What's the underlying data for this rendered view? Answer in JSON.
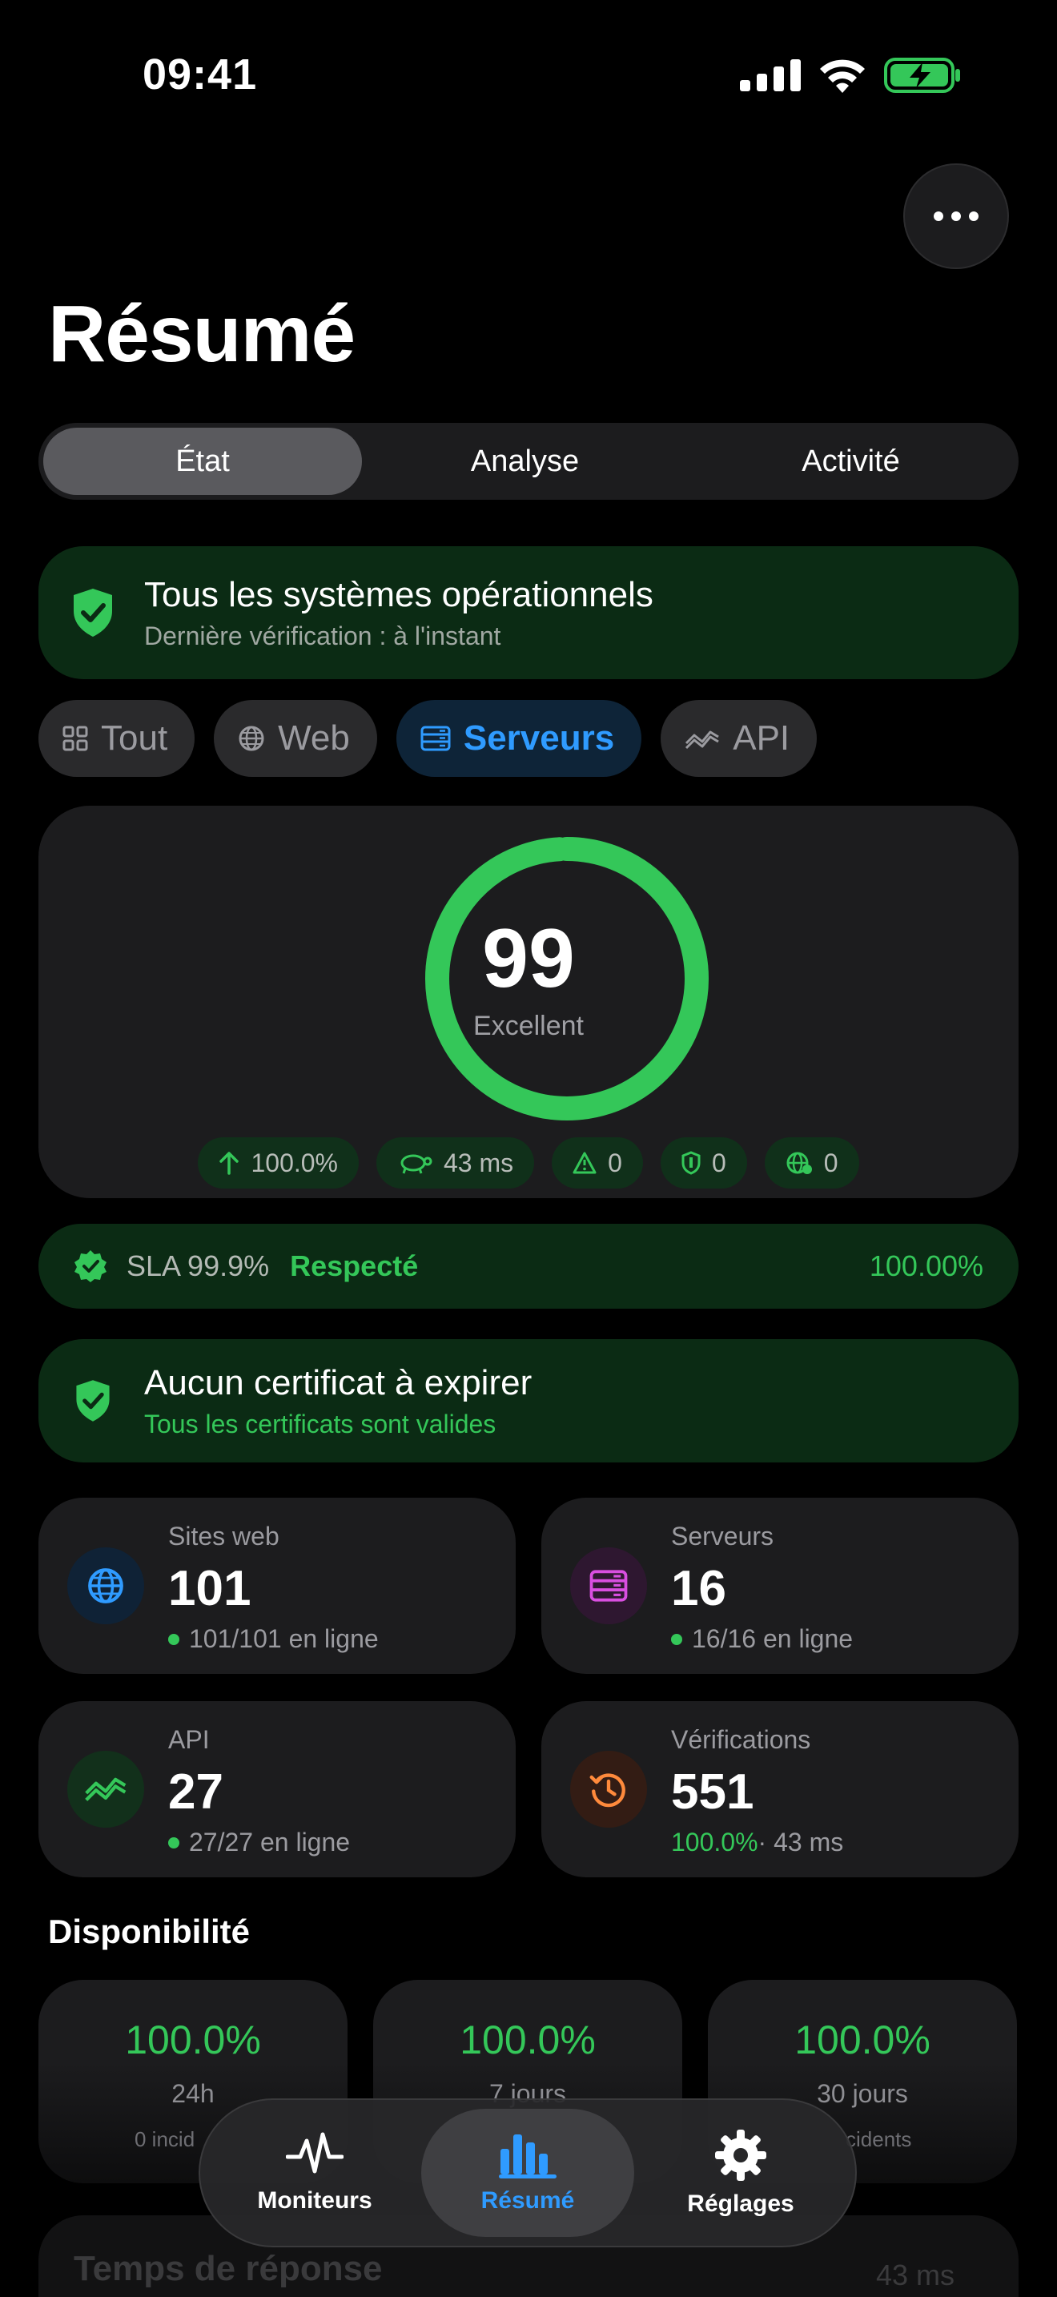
{
  "status_bar": {
    "time": "09:41"
  },
  "header": {
    "title": "Résumé"
  },
  "segments": [
    {
      "label": "État",
      "active": true
    },
    {
      "label": "Analyse",
      "active": false
    },
    {
      "label": "Activité",
      "active": false
    }
  ],
  "status_banner": {
    "title": "Tous les systèmes opérationnels",
    "subtitle": "Dernière vérification : à l'instant"
  },
  "filters": [
    {
      "label": "Tout",
      "icon": "grid-icon",
      "active": false
    },
    {
      "label": "Web",
      "icon": "globe-icon",
      "active": false
    },
    {
      "label": "Serveurs",
      "icon": "server-icon",
      "active": true
    },
    {
      "label": "API",
      "icon": "api-icon",
      "active": false
    }
  ],
  "score": {
    "value": "99",
    "label": "Excellent",
    "ring_fraction": 0.99,
    "pills": [
      {
        "icon": "arrow-up-icon",
        "text": "100.0%"
      },
      {
        "icon": "turtle-icon",
        "text": "43 ms"
      },
      {
        "icon": "warning-icon",
        "text": "0"
      },
      {
        "icon": "shield-icon",
        "text": "0"
      },
      {
        "icon": "globe-alert-icon",
        "text": "0"
      }
    ]
  },
  "sla": {
    "label": "SLA 99.9%",
    "status": "Respecté",
    "value": "100.00%"
  },
  "cert_banner": {
    "title": "Aucun certificat à expirer",
    "subtitle": "Tous les certificats sont valides"
  },
  "stats": {
    "web": {
      "label": "Sites web",
      "value": "101",
      "sub": "101/101 en ligne"
    },
    "servers": {
      "label": "Serveurs",
      "value": "16",
      "sub": "16/16 en ligne"
    },
    "api": {
      "label": "API",
      "value": "27",
      "sub": "27/27 en ligne"
    },
    "checks": {
      "label": "Vérifications",
      "value": "551",
      "sub_pct": "100.0%",
      "sub_rest": " · 43 ms"
    }
  },
  "availability": {
    "title": "Disponibilité",
    "cards": [
      {
        "pct": "100.0%",
        "period": "24h",
        "incidents": "0 incid"
      },
      {
        "pct": "100.0%",
        "period": "7 jours",
        "incidents": ""
      },
      {
        "pct": "100.0%",
        "period": "30 jours",
        "incidents": "cidents"
      }
    ]
  },
  "response_time": {
    "title": "Temps de réponse",
    "value": "43 ms"
  },
  "tabbar": [
    {
      "label": "Moniteurs",
      "icon": "waveform-icon",
      "active": false
    },
    {
      "label": "Résumé",
      "icon": "bar-chart-icon",
      "active": true
    },
    {
      "label": "Réglages",
      "icon": "gear-icon",
      "active": false
    }
  ],
  "colors": {
    "accent": "#2f9bff",
    "success": "#34c759",
    "card": "#1c1c1e"
  }
}
